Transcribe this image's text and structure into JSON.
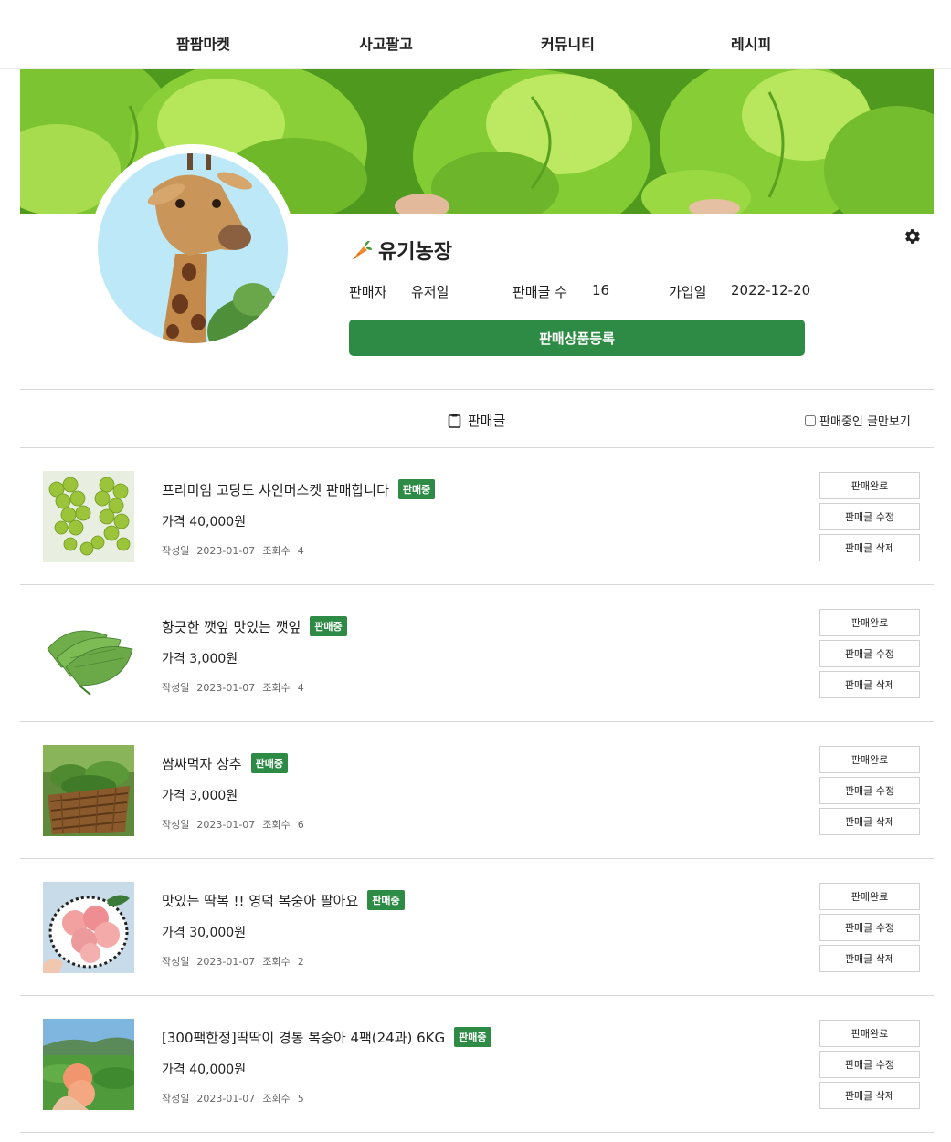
{
  "nav": {
    "items": [
      "팜팜마켓",
      "사고팔고",
      "커뮤니티",
      "레시피"
    ]
  },
  "profile": {
    "farm_name": "유기농장",
    "seller_label": "판매자",
    "seller_value": "유저일",
    "posts_label": "판매글 수",
    "posts_value": "16",
    "joined_label": "가입일",
    "joined_value": "2022-12-20",
    "register_button": "판매상품등록"
  },
  "tabs": {
    "posts_label": "판매글",
    "filter_label": "판매중인 글만보기"
  },
  "listings": [
    {
      "title": "프리미엄 고당도 샤인머스켓 판매합니다",
      "badge": "판매중",
      "price": "가격 40,000원",
      "date_label": "작성일",
      "date": "2023-01-07",
      "views_label": "조회수",
      "views": "4",
      "image": "shine-muscat-grapes"
    },
    {
      "title": "향긋한 깻잎 맛있는 깻잎",
      "badge": "판매중",
      "price": "가격 3,000원",
      "date_label": "작성일",
      "date": "2023-01-07",
      "views_label": "조회수",
      "views": "4",
      "image": "perilla-leaves"
    },
    {
      "title": "쌈싸먹자 상추",
      "badge": "판매중",
      "price": "가격 3,000원",
      "date_label": "작성일",
      "date": "2023-01-07",
      "views_label": "조회수",
      "views": "6",
      "image": "lettuce-basket"
    },
    {
      "title": "맛있는 딱복 !! 영덕 복숭아 팔아요",
      "badge": "판매중",
      "price": "가격 30,000원",
      "date_label": "작성일",
      "date": "2023-01-07",
      "views_label": "조회수",
      "views": "2",
      "image": "peaches-plate"
    },
    {
      "title": "[300팩한정]딱딱이 경봉 복숭아 4팩(24과) 6KG",
      "badge": "판매중",
      "price": "가격 40,000원",
      "date_label": "작성일",
      "date": "2023-01-07",
      "views_label": "조회수",
      "views": "5",
      "image": "peach-orchard"
    }
  ],
  "item_buttons": {
    "complete": "판매완료",
    "edit": "판매글 수정",
    "delete": "판매글 삭제"
  },
  "colors": {
    "brand_green": "#2e8b45",
    "divider": "#d8d8d8",
    "carrot_orange": "#f08a2c"
  },
  "icons": {
    "settings": "gear-icon",
    "posts_tab": "clipboard-icon",
    "farm": "carrot-icon"
  }
}
